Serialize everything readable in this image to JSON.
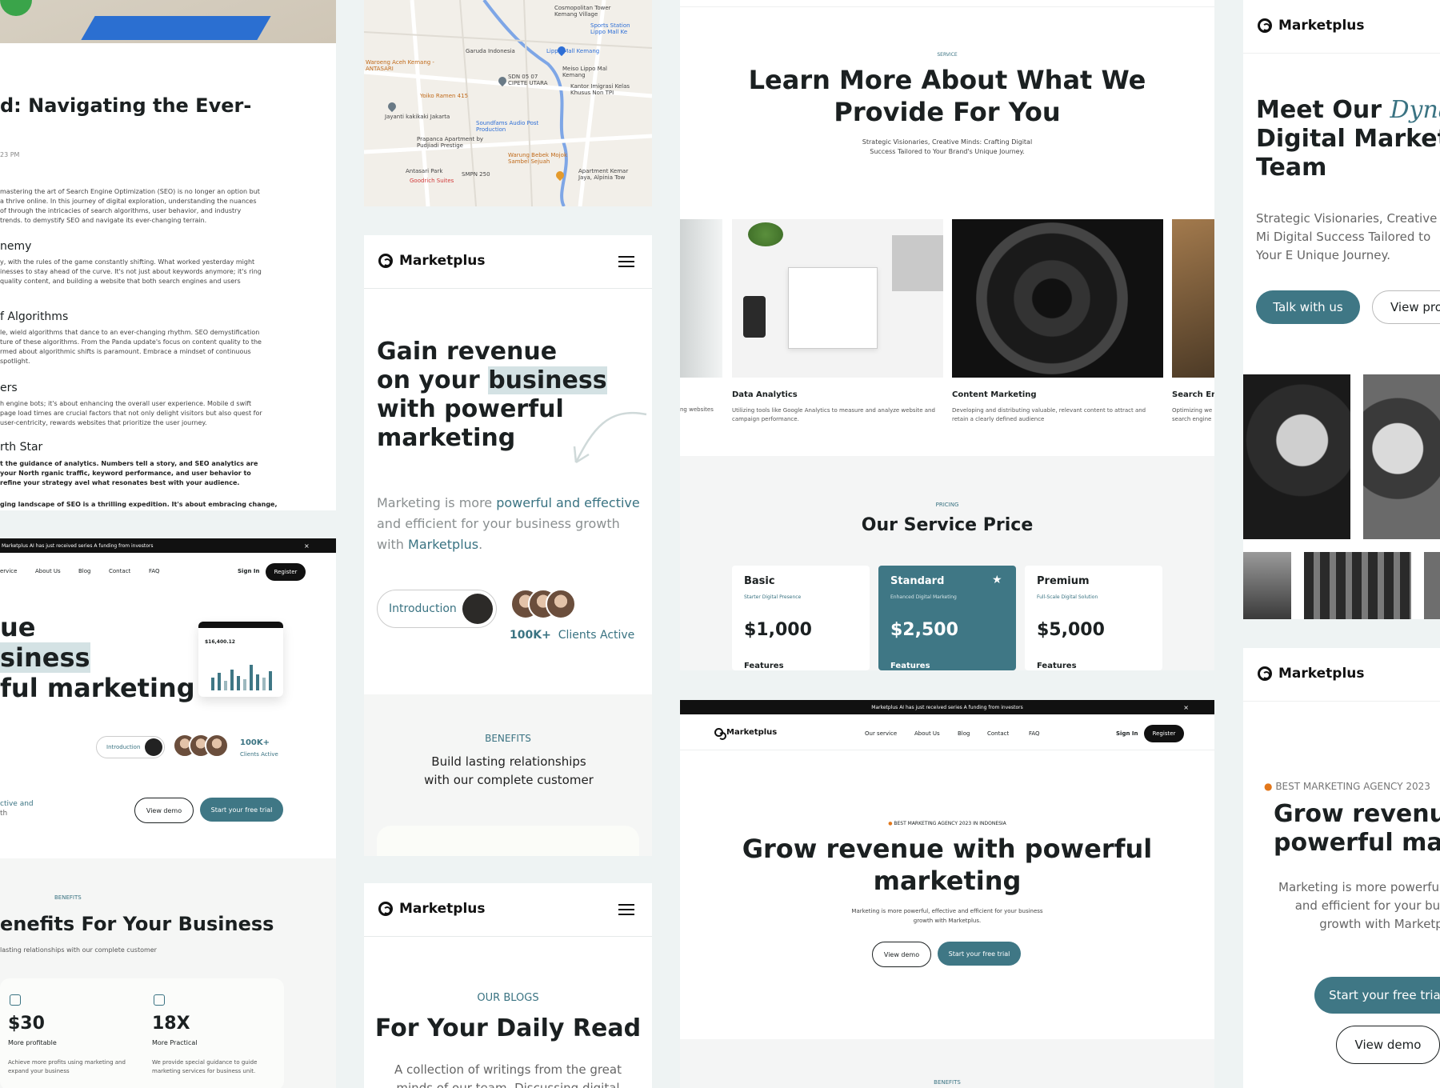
{
  "blog": {
    "heading": "d: Navigating the Ever-",
    "date": "23 PM",
    "intro": "mastering the art of Search Engine Optimization (SEO) is no longer an option but a thrive online. In this journey of digital exploration, understanding the nuances of through the intricacies of search algorithms, user behavior, and industry trends. to demystify SEO and navigate its ever-changing terrain.",
    "sections": [
      {
        "title": "nemy",
        "text": "y, with the rules of the game constantly shifting. What worked yesterday might inesses to stay ahead of the curve. It's not just about keywords anymore; it's ring quality content, and building a website that both search engines and users"
      },
      {
        "title": "f Algorithms",
        "text": "le, wield algorithms that dance to an ever-changing rhythm. SEO demystification ture of these algorithms. From the Panda update's focus on content quality to the rmed about algorithmic shifts is paramount. Embrace a mindset of continuous spotlight."
      },
      {
        "title": "ers",
        "text": "h engine bots; it's about enhancing the overall user experience. Mobile d swift page load times are crucial factors that not only delight visitors but also quest for user-centricity, rewards websites that prioritize the user journey."
      },
      {
        "title": "rth Star",
        "text": "t the guidance of analytics. Numbers tell a story, and SEO analytics are your North rganic traffic, keyword performance, and user behavior to refine your strategy avel what resonates best with your audience."
      }
    ],
    "closing": "ging landscape of SEO is a thrilling expedition. It's about embracing change,"
  },
  "hero_left": {
    "announcement": "Marketplus AI has just received series A funding from investors",
    "nav": [
      "ervice",
      "About Us",
      "Blog",
      "Contact",
      "FAQ"
    ],
    "sign_in": "Sign In",
    "register": "Register",
    "title_l1": "ue",
    "title_l2": "siness",
    "title_l3": "ful marketing",
    "dash_value": "$16,400.12",
    "intro_btn": "Introduction",
    "clients_count": "100K+",
    "clients_label": "Clients Active",
    "desc_l1": "ctive and",
    "desc_l2": "th",
    "view_demo": "View demo",
    "free_trial": "Start your free trial"
  },
  "benefits_left": {
    "eyebrow": "BENEFITS",
    "title": "enefits For Your Business",
    "subtitle": "lasting relationships with our complete customer",
    "stats": [
      {
        "value": "$30",
        "label": "More profitable",
        "desc": "Achieve more profits using marketing and expand your business"
      },
      {
        "value": "18X",
        "label": "More Practical",
        "desc": "We provide special guidance to guide marketing services for business unit."
      }
    ]
  },
  "map": {
    "labels": [
      "Cosmopolitan Tower Kemang Village",
      "Sports Station Lippo Mall Ke",
      "Garuda Indonesia",
      "Lippo Mall Kemang",
      "Waroeng Aceh Kemang - ANTASARI",
      "SDN 05 07 CIPETE UTARA",
      "Meiso Lippo Mal Kemang",
      "Yoiko Ramen 415",
      "Kantor Imigrasi Kelas Khusus Non TPI",
      "Jayanti kakikaki Jakarta",
      "Soundfams Audio Post Production",
      "Prapanca Apartment by Pudjiadi Prestige",
      "Warung Bebek Mojok Sambel Sejuah",
      "Antasari Park",
      "SMPN 250",
      "Apartment Kemar Jaya, Alpinia Tow",
      "Goodrich Suites"
    ]
  },
  "mobile1": {
    "brand": "Marketplus",
    "title_l1": "Gain revenue",
    "title_l2a": "on your ",
    "title_l2b": "business",
    "title_l3": "with powerful",
    "title_l4": "marketing",
    "desc_a": "Marketing is more ",
    "desc_b": "powerful and effective",
    "desc_c": " and efficient for your business growth with ",
    "desc_d": "Marketplus",
    "desc_e": ".",
    "intro_btn": "Introduction",
    "clients_count": "100K+",
    "clients_label": "Clients Active",
    "benefits_eyebrow": "BENEFITS",
    "benefits_text": "Build lasting relationships with our complete customer"
  },
  "mobile2": {
    "brand": "Marketplus",
    "eyebrow": "OUR BLOGS",
    "title": "For Your Daily Read",
    "desc": "A collection of writings from the great minds of our team. Discussing digital marketing"
  },
  "service": {
    "eyebrow": "SERVICE",
    "title_l1": "Learn More About What We",
    "title_l2": "Provide For You",
    "subtitle": "Strategic Visionaries, Creative Minds: Crafting Digital Success Tailored to Your Brand's Unique Journey.",
    "cards": [
      {
        "title": "",
        "desc": "ng websites"
      },
      {
        "title": "Data Analytics",
        "desc": "Utilizing tools like Google Analytics to measure and analyze website and campaign performance."
      },
      {
        "title": "Content Marketing",
        "desc": "Developing and distributing valuable, relevant content to attract and retain a clearly defined audience"
      },
      {
        "title": "Search En",
        "desc": "Optimizing we search engine"
      }
    ],
    "pricing_eyebrow": "PRICING",
    "pricing_title": "Our Service Price",
    "plans": [
      {
        "name": "Basic",
        "tag": "Starter Digital Presence",
        "price": "$1,000",
        "features": "Features"
      },
      {
        "name": "Standard",
        "tag": "Enhanced Digital Marketing",
        "price": "$2,500",
        "features": "Features"
      },
      {
        "name": "Premium",
        "tag": "Full-Scale Digital Solution",
        "price": "$5,000",
        "features": "Features"
      }
    ]
  },
  "desktop_hero": {
    "announcement": "Marketplus AI has just received series A funding from investors",
    "brand": "Marketplus",
    "nav": [
      "Our service",
      "About Us",
      "Blog",
      "Contact",
      "FAQ"
    ],
    "sign_in": "Sign In",
    "register": "Register",
    "badge": "BEST MARKETING AGENCY 2023 IN INDONESIA",
    "title_l1": "Grow revenue with powerful",
    "title_l2": "marketing",
    "desc": "Marketing is more powerful, effective and efficient for your business growth with Marketplus.",
    "view_demo": "View demo",
    "free_trial": "Start your free trial",
    "benefits_eyebrow": "BENEFITS"
  },
  "team": {
    "brand": "Marketplus",
    "title_a": "Meet Our ",
    "title_b": "Dynam",
    "title_l2": "Digital Marketin",
    "title_l3": "Team",
    "desc": "Strategic Visionaries, Creative Mi Digital Success Tailored to Your E Unique Journey.",
    "talk_btn": "Talk with us",
    "view_btn": "View pro"
  },
  "right_hero": {
    "brand": "Marketplus",
    "badge": "BEST MARKETING AGENCY 2023",
    "title_l1": "Grow revenue",
    "title_l2": "powerful mark",
    "desc": "Marketing is more powerful, and efficient for your bus growth with Marketpl",
    "free_trial": "Start your free trial",
    "view_demo": "View demo"
  }
}
